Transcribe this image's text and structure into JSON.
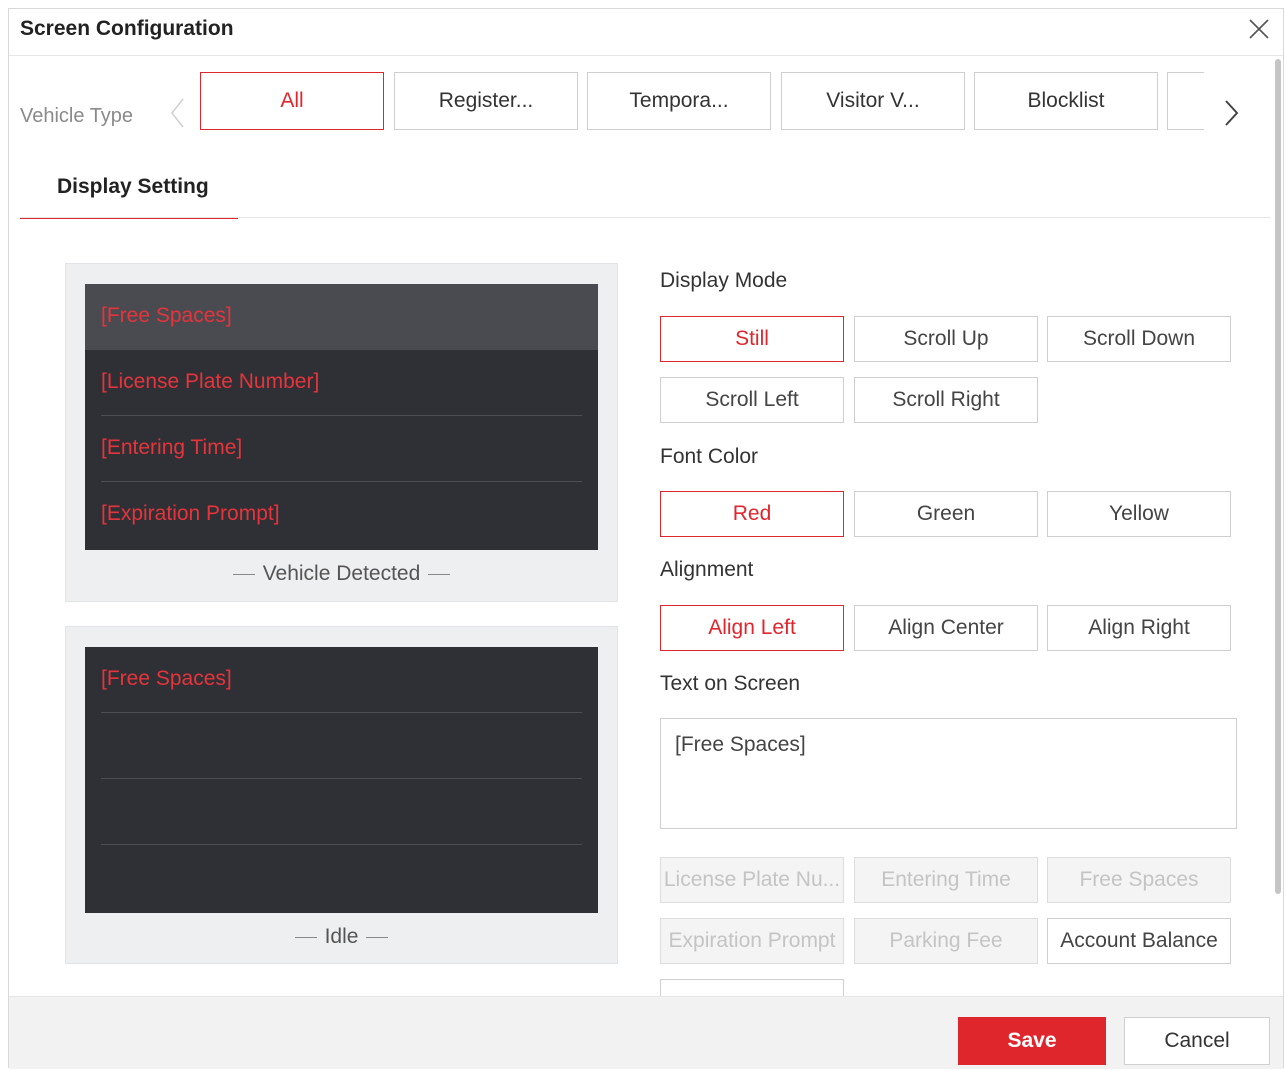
{
  "dialog": {
    "title": "Screen Configuration",
    "close_icon": "close-icon"
  },
  "vehicle_type": {
    "label": "Vehicle Type",
    "tabs": [
      "All",
      "Register...",
      "Tempora...",
      "Visitor V...",
      "Blocklist"
    ],
    "selected": "All",
    "prev_icon": "chevron-left-icon",
    "next_icon": "chevron-right-icon"
  },
  "section_tab": "Display Setting",
  "preview_detected": {
    "rows": [
      "[Free Spaces]",
      "[License Plate Number]",
      "[Entering Time]",
      "[Expiration Prompt]"
    ],
    "caption": "Vehicle Detected"
  },
  "preview_idle": {
    "rows": [
      "[Free Spaces]",
      "",
      "",
      ""
    ],
    "caption": "Idle"
  },
  "display_mode": {
    "label": "Display Mode",
    "options": [
      "Still",
      "Scroll Up",
      "Scroll Down",
      "Scroll Left",
      "Scroll Right"
    ],
    "selected": "Still"
  },
  "font_color": {
    "label": "Font Color",
    "options": [
      "Red",
      "Green",
      "Yellow"
    ],
    "selected": "Red"
  },
  "alignment": {
    "label": "Alignment",
    "options": [
      "Align Left",
      "Align Center",
      "Align Right"
    ],
    "selected": "Align Left"
  },
  "text_on_screen": {
    "label": "Text on Screen",
    "value": "[Free Spaces]"
  },
  "insert_fields": {
    "options": [
      "License Plate Nu...",
      "Entering Time",
      "Free Spaces",
      "Expiration Prompt",
      "Parking Fee",
      "Account Balance"
    ],
    "enabled": [
      "Account Balance"
    ]
  },
  "footer": {
    "save_label": "Save",
    "cancel_label": "Cancel"
  },
  "colors": {
    "accent": "#e0262d",
    "led_background": "#2f3035",
    "led_text": "#e5343b"
  }
}
